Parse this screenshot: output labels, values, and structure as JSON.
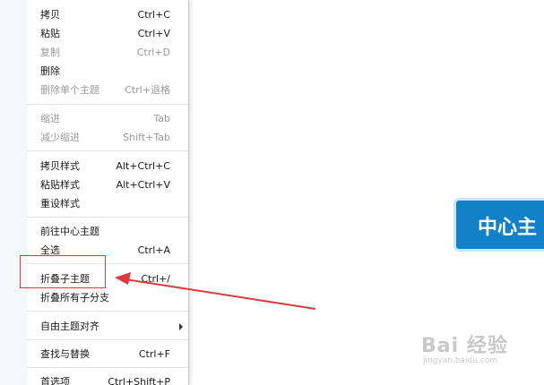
{
  "menu": {
    "copy": {
      "label": "拷贝",
      "shortcut": "Ctrl+C"
    },
    "paste": {
      "label": "粘贴",
      "shortcut": "Ctrl+V"
    },
    "duplicate": {
      "label": "复制",
      "shortcut": "Ctrl+D"
    },
    "delete": {
      "label": "删除",
      "shortcut": ""
    },
    "delete_single_topic": {
      "label": "删除单个主题",
      "shortcut": "Ctrl+退格"
    },
    "indent": {
      "label": "缩进",
      "shortcut": "Tab"
    },
    "outdent": {
      "label": "减少缩进",
      "shortcut": "Shift+Tab"
    },
    "copy_style": {
      "label": "拷贝样式",
      "shortcut": "Alt+Ctrl+C"
    },
    "paste_style": {
      "label": "粘贴样式",
      "shortcut": "Alt+Ctrl+V"
    },
    "reset_style": {
      "label": "重设样式",
      "shortcut": ""
    },
    "go_central_topic": {
      "label": "前往中心主题",
      "shortcut": ""
    },
    "select_all": {
      "label": "全选",
      "shortcut": "Ctrl+A"
    },
    "collapse_subtopics": {
      "label": "折叠子主题",
      "shortcut": "Ctrl+/"
    },
    "collapse_all_branches": {
      "label": "折叠所有子分支",
      "shortcut": ""
    },
    "free_topic_align": {
      "label": "自由主题对齐",
      "shortcut": ""
    },
    "find_replace": {
      "label": "查找与替换",
      "shortcut": "Ctrl+F"
    },
    "preferences": {
      "label": "首选项",
      "shortcut": "Ctrl+Shift+P"
    }
  },
  "canvas": {
    "central_topic_text": "中心主"
  },
  "watermark": {
    "main": "Bai 经验",
    "sub": "jingyan.baidu.com"
  },
  "colors": {
    "highlight_box": "#e0393b",
    "arrow": "#e0393b",
    "topic_fill": "#1281c9",
    "topic_border": "#cfe5f5",
    "disabled_text": "#9a9a9a"
  },
  "icons": {
    "submenu_arrow": "chevron-right-icon",
    "annotation_arrow": "arrow-left-icon"
  }
}
